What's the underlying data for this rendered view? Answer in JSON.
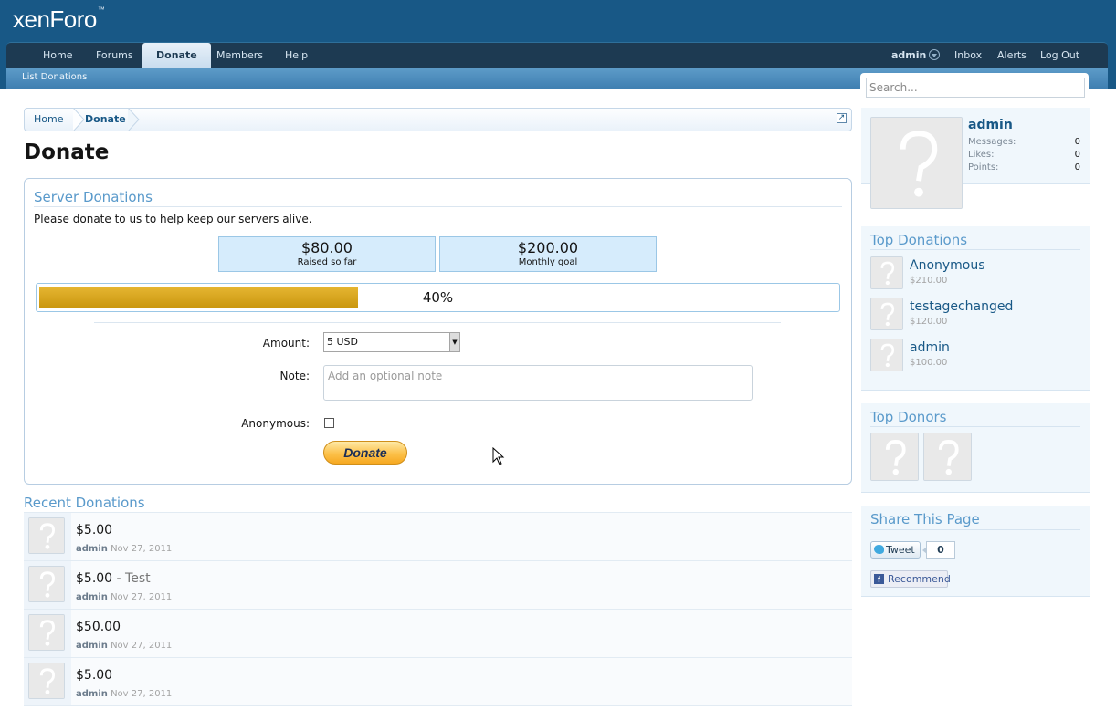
{
  "header": {
    "logo_text": "xenForo",
    "logo_mark": "™"
  },
  "nav": {
    "tabs": [
      {
        "label": "Home"
      },
      {
        "label": "Forums"
      },
      {
        "label": "Donate",
        "selected": true
      },
      {
        "label": "Members"
      },
      {
        "label": "Help"
      }
    ],
    "user": "admin",
    "inbox": "Inbox",
    "alerts": "Alerts",
    "logout": "Log Out",
    "subnav": "List Donations"
  },
  "search": {
    "placeholder": "Search..."
  },
  "breadcrumb": {
    "items": [
      "Home",
      "Donate"
    ]
  },
  "page_title": "Donate",
  "donation_box": {
    "title": "Server Donations",
    "description": "Please donate to us to help keep our servers alive.",
    "raised_value": "$80.00",
    "raised_label": "Raised so far",
    "goal_value": "$200.00",
    "goal_label": "Monthly goal",
    "progress_fraction": 0.4,
    "progress_text": "40%",
    "amount_label": "Amount:",
    "amount_value": "5 USD",
    "note_label": "Note:",
    "note_placeholder": "Add an optional note",
    "anonymous_label": "Anonymous:",
    "donate_button": "Donate"
  },
  "recent": {
    "title": "Recent Donations",
    "rows": [
      {
        "amount": "$5.00",
        "note": "",
        "user": "admin",
        "date": "Nov 27, 2011"
      },
      {
        "amount": "$5.00",
        "note": "- Test",
        "user": "admin",
        "date": "Nov 27, 2011"
      },
      {
        "amount": "$50.00",
        "note": "",
        "user": "admin",
        "date": "Nov 27, 2011"
      },
      {
        "amount": "$5.00",
        "note": "",
        "user": "admin",
        "date": "Nov 27, 2011"
      }
    ]
  },
  "sidebar": {
    "visitor": {
      "name": "admin",
      "stats": [
        {
          "label": "Messages:",
          "value": "0"
        },
        {
          "label": "Likes:",
          "value": "0"
        },
        {
          "label": "Points:",
          "value": "0"
        }
      ]
    },
    "top_donations": {
      "title": "Top Donations",
      "items": [
        {
          "name": "Anonymous",
          "amount": "$210.00"
        },
        {
          "name": "testagechanged",
          "amount": "$120.00"
        },
        {
          "name": "admin",
          "amount": "$100.00"
        }
      ]
    },
    "top_donors": {
      "title": "Top Donors"
    },
    "share": {
      "title": "Share This Page",
      "tweet": "Tweet",
      "tweet_count": "0",
      "recommend": "Recommend",
      "fb_glyph": "f"
    }
  },
  "colors": {
    "header_bg": "#185886",
    "accent_title": "#5a9acb",
    "progress_fill": "#c9960e",
    "stat_box_bg": "#d6ecfc"
  }
}
